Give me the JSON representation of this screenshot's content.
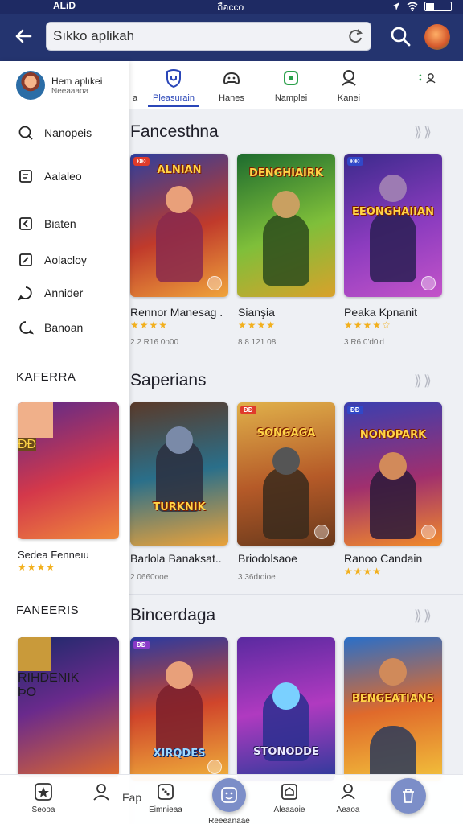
{
  "status_bar": {
    "left": "ALiD",
    "center": "ถือcco"
  },
  "search": {
    "value": "Sıkko aplikah"
  },
  "tabs": [
    {
      "label": "a",
      "icon": "partial-icon"
    },
    {
      "label": "Pleasurain",
      "icon": "shield-icon",
      "active": true
    },
    {
      "label": "Hanes",
      "icon": "gamepad-icon"
    },
    {
      "label": "Namplei",
      "icon": "apps-icon"
    },
    {
      "label": "Kanei",
      "icon": "person-icon"
    }
  ],
  "drawer": {
    "profile_name": "Hem aplıkei",
    "profile_sub": "Neeaaaoa",
    "menu": [
      {
        "label": "Nanopeis",
        "icon": "search-icon"
      },
      {
        "label": "Aalaleo",
        "icon": "document-icon"
      },
      {
        "label": "Biaten",
        "icon": "back-box-icon"
      },
      {
        "label": "Aolacloy",
        "icon": "edit-icon"
      },
      {
        "label": "Annider",
        "icon": "chat-icon"
      },
      {
        "label": "Banoan",
        "icon": "bubble-icon"
      }
    ],
    "section1": "KAFERRA",
    "card1": {
      "badge": "ÐÐ",
      "name": "Sedea Fenneıu",
      "stars": "★★★★"
    },
    "section2": "FANEERIS",
    "card2": {
      "badge": "ÞO",
      "art": "RIHDENIK"
    }
  },
  "sections": [
    {
      "title": "Fancesthna",
      "cards": [
        {
          "badge": "ÐÐ",
          "art": "ALNIAN",
          "name": "Rennor Manesag .",
          "stars": "★★★★",
          "meta": "2.2 R16 0o00"
        },
        {
          "badge": "",
          "art": "DENGHIAIRK",
          "name": "Sianşia",
          "stars": "★★★★",
          "meta": "8 8 121 08"
        },
        {
          "badge": "ÐÐ",
          "art": "EEONGHAIIAN",
          "name": "Peaka Kpnanit",
          "stars": "★★★★☆",
          "meta": "3 R6 0'd0'd"
        }
      ]
    },
    {
      "title": "Saperians",
      "cards": [
        {
          "badge": "",
          "art": "TURKNIK",
          "name": "Barlola Banaksat..",
          "stars": "",
          "meta": "2 0660ooe"
        },
        {
          "badge": "ÐÐ",
          "art": "SONGAGA",
          "name": "Briodolsaoe",
          "stars": "",
          "meta": "3 36dıoioe"
        },
        {
          "badge": "ÐÐ",
          "art": "NONOPARK",
          "name": "Ranoo Candain",
          "stars": "★★★★",
          "meta": ""
        }
      ]
    },
    {
      "title": "Bincerdaga",
      "cards": [
        {
          "badge": "ÐÐ",
          "art": "XIRQDES"
        },
        {
          "badge": "",
          "art": "STONODDE"
        },
        {
          "badge": "",
          "art": "BENGEATIANS"
        }
      ]
    }
  ],
  "bottom_nav": [
    {
      "label": "Seooa",
      "icon": "star-icon"
    },
    {
      "label": "",
      "icon": "profile-icon"
    },
    {
      "label": "Fap",
      "icon": ""
    },
    {
      "label": "Eimnieaa",
      "icon": "dice-icon"
    },
    {
      "label": "Reeeanaae",
      "icon": "face-icon"
    },
    {
      "label": "Aleaaoie",
      "icon": "home-icon"
    },
    {
      "label": "Aeaoa",
      "icon": "people-icon"
    }
  ],
  "colors": {
    "header": "#24346f",
    "accent": "#2a46b8",
    "star": "#f2b01e"
  }
}
